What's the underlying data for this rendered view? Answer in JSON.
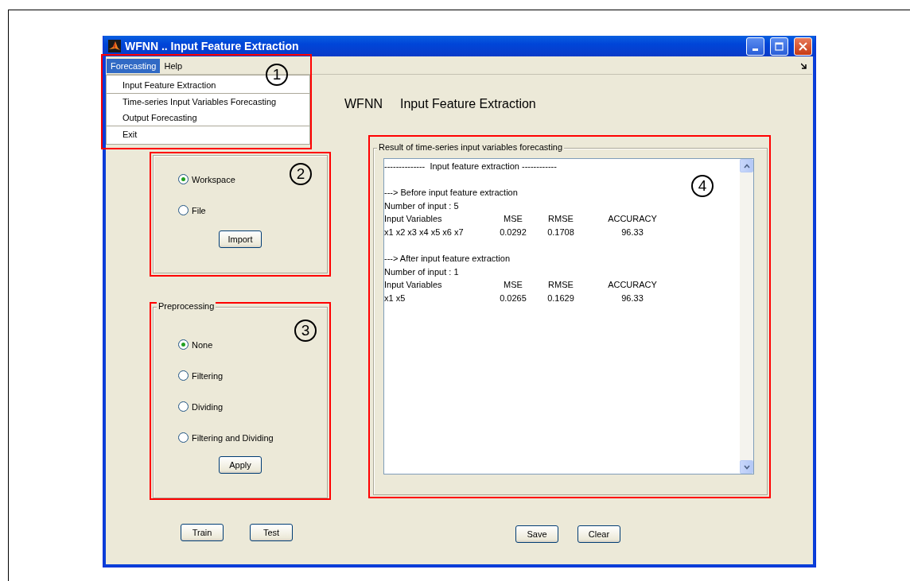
{
  "window": {
    "title": "WFNN .. Input Feature Extraction"
  },
  "menu_bar": [
    {
      "label": "Forecasting",
      "selected": true
    },
    {
      "label": "Help",
      "selected": false
    }
  ],
  "open_menu": {
    "annotation": "1",
    "items": [
      {
        "label": "Input Feature Extraction",
        "separator_before": false
      },
      {
        "label": "Time-series Input Variables Forecasting",
        "separator_before": true
      },
      {
        "label": "Output Forecasting",
        "separator_before": false
      },
      {
        "label": "Exit",
        "separator_before": true
      }
    ]
  },
  "heading": [
    "WFNN",
    "Input Feature Extraction"
  ],
  "data_panel": {
    "annotation": "2",
    "options": [
      {
        "label": "Workspace",
        "selected": true
      },
      {
        "label": "File",
        "selected": false
      }
    ],
    "button": "Import"
  },
  "preprocessing_panel": {
    "annotation": "3",
    "title": "Preprocessing",
    "options": [
      {
        "label": "None",
        "selected": true
      },
      {
        "label": "Filtering",
        "selected": false
      },
      {
        "label": "Dividing",
        "selected": false
      },
      {
        "label": "Filtering and Dividing",
        "selected": false
      }
    ],
    "button": "Apply"
  },
  "result_panel": {
    "annotation": "4",
    "title": "Result of time-series input variables forecasting",
    "lines": [
      {
        "kind": "text",
        "text": "--------------  Input feature extraction ------------"
      },
      {
        "kind": "blank"
      },
      {
        "kind": "text",
        "text": "---> Before input feature extraction"
      },
      {
        "kind": "text",
        "text": "Number of input : 5"
      },
      {
        "kind": "row",
        "cells": [
          "Input Variables",
          "MSE",
          "RMSE",
          "ACCURACY"
        ]
      },
      {
        "kind": "row",
        "cells": [
          "x1 x2 x3 x4 x5 x6 x7",
          "0.0292",
          "0.1708",
          "96.33"
        ]
      },
      {
        "kind": "blank"
      },
      {
        "kind": "text",
        "text": "---> After input feature extraction"
      },
      {
        "kind": "text",
        "text": "Number of input : 1"
      },
      {
        "kind": "row",
        "cells": [
          "Input Variables",
          "MSE",
          "RMSE",
          "ACCURACY"
        ]
      },
      {
        "kind": "row",
        "cells": [
          "x1 x5",
          "0.0265",
          "0.1629",
          "96.33"
        ]
      }
    ]
  },
  "buttons_left": [
    "Train",
    "Test"
  ],
  "buttons_right": [
    "Save",
    "Clear"
  ]
}
